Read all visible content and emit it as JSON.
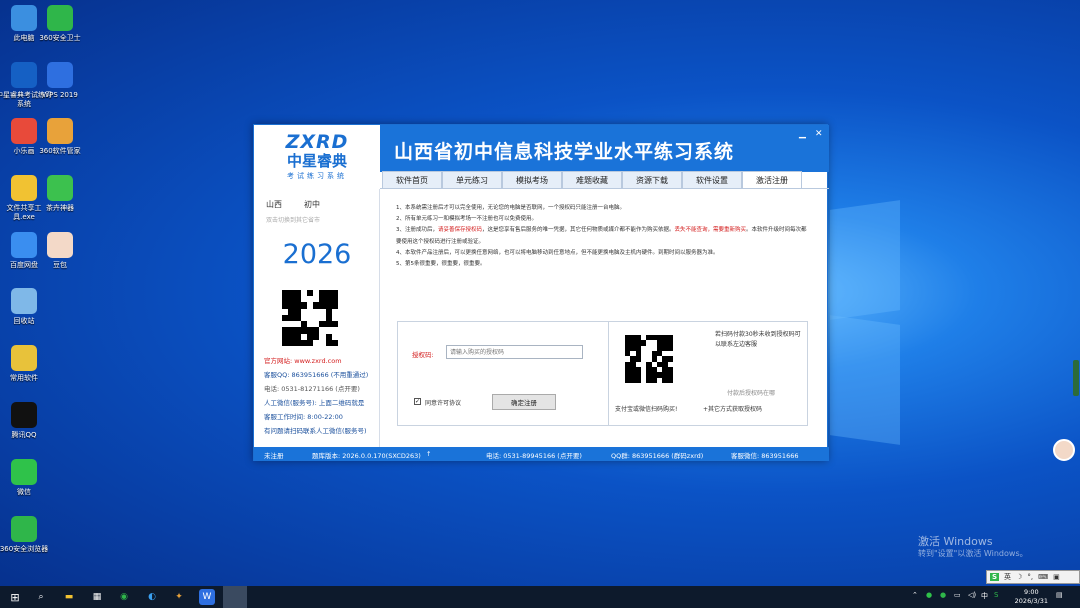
{
  "desktop": {
    "icons": [
      {
        "label": "此电脑",
        "icon": "computer-icon",
        "color": "#3b8fe0"
      },
      {
        "label": "360安全卫士",
        "icon": "shield-plus-icon",
        "color": "#2fb64a"
      },
      {
        "label": "中星睿典考试练习系统",
        "icon": "it-exam-icon",
        "color": "#1560c4"
      },
      {
        "label": "WPS 2019",
        "icon": "wps-icon",
        "color": "#2e6fe0"
      },
      {
        "label": "小乐画",
        "icon": "game-char-icon",
        "color": "#e84a3a"
      },
      {
        "label": "360软件管家",
        "icon": "software-manager-icon",
        "color": "#e8a23a"
      },
      {
        "label": "文件共享工具.exe",
        "icon": "folder-icon",
        "color": "#f1c232"
      },
      {
        "label": "茶卉神器",
        "icon": "wechat-tool-icon",
        "color": "#3cc14e"
      },
      {
        "label": "百度网盘",
        "icon": "baidu-netdisk-icon",
        "color": "#3a8ef0"
      },
      {
        "label": "豆包",
        "icon": "doubao-avatar-icon",
        "color": "#f3d9c8"
      },
      {
        "label": "回收站",
        "icon": "recycle-bin-icon",
        "color": "#7fb8e8"
      },
      {
        "label": "常用软件",
        "icon": "archive-icon",
        "color": "#e8c23a"
      },
      {
        "label": "腾讯QQ",
        "icon": "qq-icon",
        "color": "#111111"
      },
      {
        "label": "微信",
        "icon": "wechat-icon",
        "color": "#2fc24a"
      },
      {
        "label": "360安全浏览器",
        "icon": "360-browser-icon",
        "color": "#2fb64a"
      }
    ]
  },
  "app": {
    "logo_text": "ZXRD",
    "logo_cn": "中星睿典",
    "logo_sub": "考试练习系统",
    "title": "山西省初中信息科技学业水平练习系统",
    "tabs": [
      "软件首页",
      "单元练习",
      "模拟考场",
      "难题收藏",
      "资源下载",
      "软件设置",
      "激活注册"
    ],
    "active_tab": "激活注册",
    "colors": {
      "accent": "#1a73d9",
      "warning": "#d42020"
    }
  },
  "left": {
    "province": "山西",
    "level": "初中",
    "hint": "双击切换到其它省市",
    "year": "2026",
    "website": "官方网站: www.zxrd.com",
    "qq": "客服QQ: 863951666 (不用重通过)",
    "phone": "电话: 0531-81271166 (点开要)",
    "wechat": "人工微信(服务号): 上面二维码就是",
    "hours": "客服工作时间: 8:00-22:00",
    "note": "有问题请扫码联系人工微信(服务号)"
  },
  "notes": {
    "line1": "1、本系统需注册后才可以完全使用，无论您的电脑是否联网，一个授权码只能注册一台电脑。",
    "line2": "2、所有单元练习一和模拟考场一不注册也可以免费使用。",
    "line3a": "3、注册成功后，",
    "line3b": "请妥善保存授权码",
    "line3c": "，这是您享有售后服务的唯一凭据，其它任何物质或媒介都不能作为购买依据。",
    "line3d": "丢失不能查询，需要重新购买",
    "line3e": "。本软件升级时间每次都要使用这个授权码进行注册或验证。",
    "line4": "4、本软件产品注册后，可以更换任意网络，也可以将电脑移动到任意地点，但不能更换电脑及主机内硬件。到期时间以服务器为准。",
    "line5": "5、第5条很重要，很重要，很重要。"
  },
  "register": {
    "label": "授权码:",
    "placeholder": "请输入购买的授权码",
    "agree": "同意许可协议",
    "agree_checked": true,
    "button": "确定注册"
  },
  "pay": {
    "scan_text": "若扫码付款30秒未收到授权码可以联系左边客服",
    "after_text": "付款后授权码在哪",
    "pay_hint": "支付宝或微信扫码购买!",
    "other": "+其它方式获取授权码"
  },
  "status": {
    "reg_state": "未注册",
    "version": "题库版本: 2026.0.0.170(SXCD263)",
    "phone": "电话: 0531-89945166 (点开要)",
    "qq": "QQ群: 863951666 (群码zxrd)",
    "wechat": "客服微信: 863951666"
  },
  "watermark": {
    "title": "激活 Windows",
    "sub": "转到\"设置\"以激活 Windows。"
  },
  "taskbar": {
    "time": "9:00",
    "date": "2026/3/31",
    "ime": "英",
    "tray_lang": "中"
  }
}
